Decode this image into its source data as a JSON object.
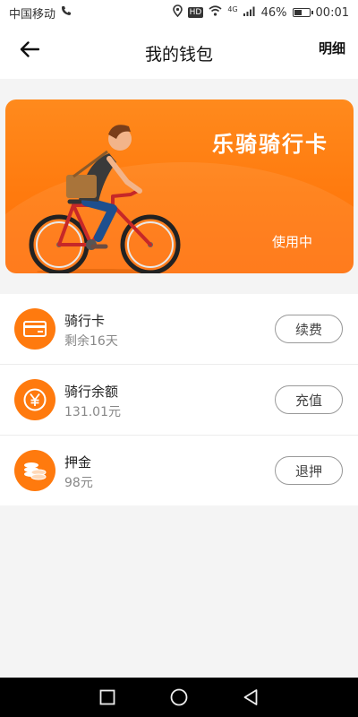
{
  "statusbar": {
    "carrier": "中国移动",
    "hd": "HD",
    "network": "4G",
    "battery": "46%",
    "battery_level": 0.46,
    "time": "00:01"
  },
  "header": {
    "title": "我的钱包",
    "detail": "明细"
  },
  "card": {
    "title": "乐骑骑行卡",
    "status": "使用中"
  },
  "items": [
    {
      "name": "骑行卡",
      "sub": "剩余16天",
      "button": "续费",
      "icon": "card-icon"
    },
    {
      "name": "骑行余额",
      "sub": "131.01元",
      "button": "充值",
      "icon": "yen-icon"
    },
    {
      "name": "押金",
      "sub": "98元",
      "button": "退押",
      "icon": "coins-icon"
    }
  ],
  "colors": {
    "accent": "#ff7a0e",
    "card_top": "#ff8a1d",
    "card_bottom": "#ff700a"
  }
}
